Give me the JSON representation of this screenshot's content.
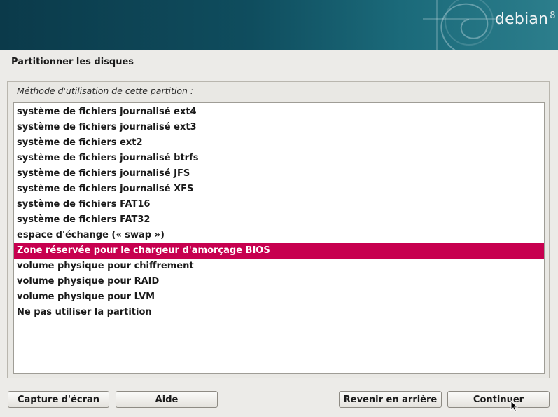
{
  "banner": {
    "logo_text": "debian",
    "logo_version": "8"
  },
  "page": {
    "title": "Partitionner les disques"
  },
  "group": {
    "label": "Méthode d'utilisation de cette partition :"
  },
  "list": {
    "items": [
      {
        "label": "système de fichiers journalisé ext4"
      },
      {
        "label": "système de fichiers journalisé ext3"
      },
      {
        "label": "système de fichiers ext2"
      },
      {
        "label": "système de fichiers journalisé btrfs"
      },
      {
        "label": "système de fichiers journalisé JFS"
      },
      {
        "label": "système de fichiers journalisé XFS"
      },
      {
        "label": "système de fichiers FAT16"
      },
      {
        "label": "système de fichiers FAT32"
      },
      {
        "label": "espace d'échange (« swap »)"
      },
      {
        "label": "Zone réservée pour le chargeur d'amorçage BIOS",
        "selected": true
      },
      {
        "label": "volume physique pour chiffrement"
      },
      {
        "label": "volume physique pour RAID"
      },
      {
        "label": "volume physique pour LVM"
      },
      {
        "label": "Ne pas utiliser la partition"
      }
    ],
    "selection_color": "#c7004f"
  },
  "buttons": {
    "screenshot": "Capture d'écran",
    "help": "Aide",
    "back": "Revenir en arrière",
    "continue": "Continuer"
  }
}
